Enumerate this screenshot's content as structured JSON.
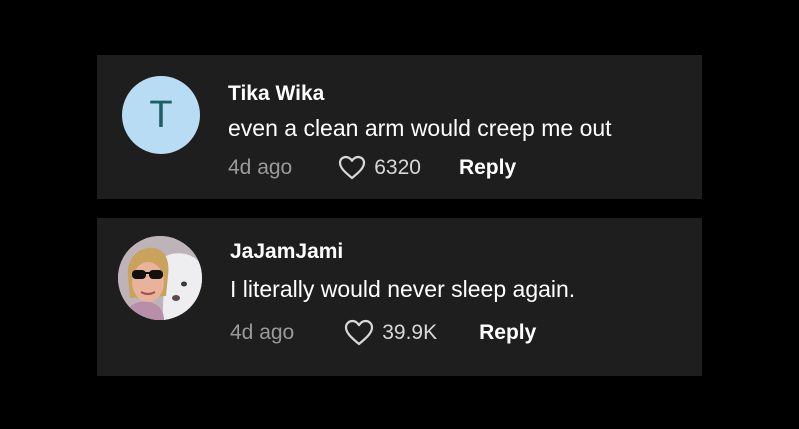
{
  "comments": [
    {
      "avatar_letter": "T",
      "avatar_color": "#b9dcf5",
      "username": "Tika Wika",
      "text": "even a clean arm would creep me out",
      "time": "4d ago",
      "likes": "6320",
      "reply_label": "Reply",
      "like_icon": "heart-outline-icon"
    },
    {
      "avatar_type": "photo",
      "username": "JaJamJami",
      "text": "I literally would never sleep again.",
      "time": "4d ago",
      "likes": "39.9K",
      "reply_label": "Reply",
      "like_icon": "heart-outline-icon"
    }
  ],
  "colors": {
    "background": "#000000",
    "card": "#1e1e1e",
    "secondary_text": "#9a9a9a",
    "primary_text": "#ffffff"
  }
}
